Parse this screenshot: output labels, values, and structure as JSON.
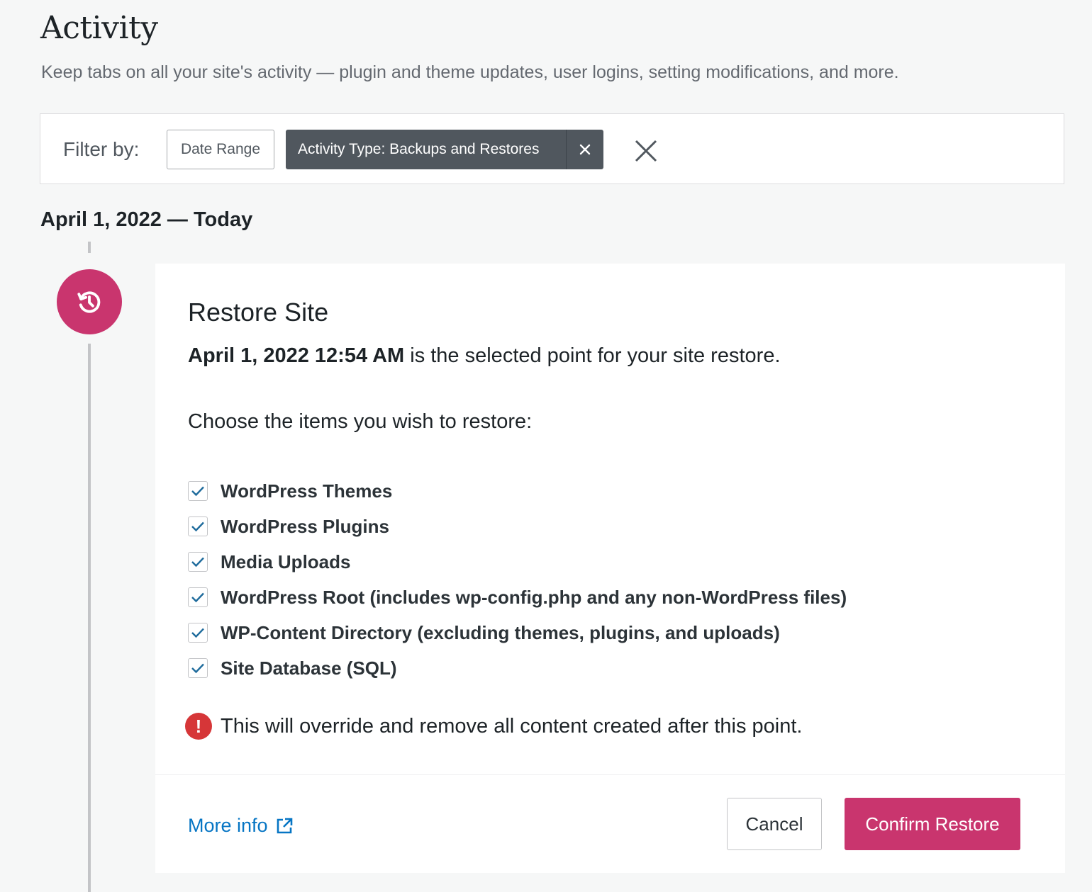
{
  "header": {
    "title": "Activity",
    "subtitle": "Keep tabs on all your site's activity — plugin and theme updates, user logins, setting modifications, and more."
  },
  "filter": {
    "label": "Filter by:",
    "date_range_label": "Date Range",
    "active_filter_label": "Activity Type: Backups and Restores",
    "remove_filter_icon": "close-icon",
    "clear_all_icon": "close-icon"
  },
  "timeline": {
    "date_heading": "April 1, 2022 — Today",
    "icon": "restore-history-icon",
    "accent_color": "#c9356e"
  },
  "restore_card": {
    "title": "Restore Site",
    "selected_point_bold": "April 1, 2022 12:54 AM",
    "selected_point_rest": " is the selected point for your site restore.",
    "choose_label": "Choose the items you wish to restore:",
    "options": [
      {
        "label": "WordPress Themes",
        "checked": true
      },
      {
        "label": "WordPress Plugins",
        "checked": true
      },
      {
        "label": "Media Uploads",
        "checked": true
      },
      {
        "label": "WordPress Root (includes wp-config.php and any non-WordPress files)",
        "checked": true
      },
      {
        "label": "WP-Content Directory (excluding themes, plugins, and uploads)",
        "checked": true
      },
      {
        "label": "Site Database (SQL)",
        "checked": true
      }
    ],
    "warning_icon": "!",
    "warning_text": "This will override and remove all content created after this point.",
    "more_info_label": "More info",
    "cancel_label": "Cancel",
    "confirm_label": "Confirm Restore"
  }
}
